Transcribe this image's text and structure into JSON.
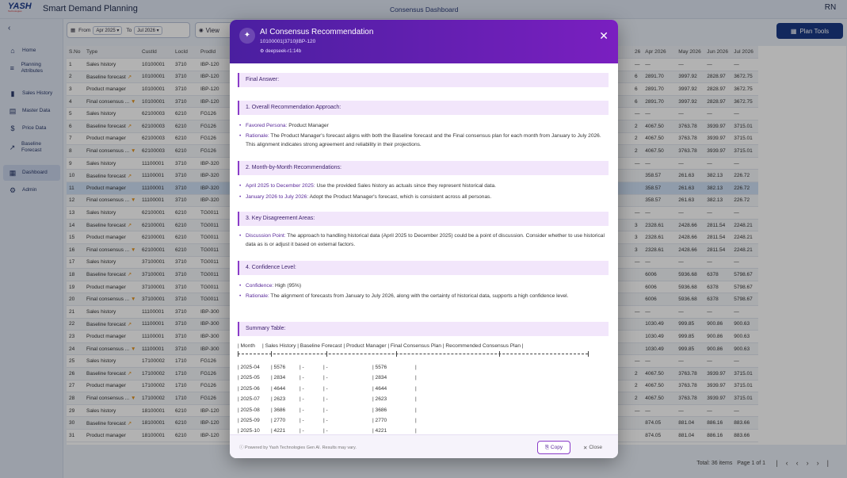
{
  "header": {
    "logo_text": "YASH",
    "logo_tagline": "Technologies",
    "app_title": "Smart Demand Planning",
    "page_title": "Consensus Dashboard",
    "user_initials": "RN"
  },
  "sidebar": {
    "collapse_icon": "chevron-left-icon",
    "items": [
      {
        "label": "Home",
        "icon": "home-icon",
        "glyph": "⌂"
      },
      {
        "label": "Planning Attributes",
        "icon": "list-icon",
        "glyph": "≡"
      },
      {
        "label": "Sales History",
        "icon": "bar-chart-icon",
        "glyph": "▮"
      },
      {
        "label": "Master Data",
        "icon": "database-icon",
        "glyph": "▤"
      },
      {
        "label": "Price Data",
        "icon": "dollar-icon",
        "glyph": "$"
      },
      {
        "label": "Baseline Forecast",
        "icon": "trend-icon",
        "glyph": "↗"
      },
      {
        "label": "Dashboard",
        "icon": "dashboard-icon",
        "glyph": "▦"
      },
      {
        "label": "Admin",
        "icon": "admin-icon",
        "glyph": "⚙"
      }
    ]
  },
  "filters": {
    "from_label": "From",
    "from_value": "Apr 2025",
    "to_label": "To",
    "to_value": "Jul 2026",
    "view_label": "View",
    "plan_tools_label": "Plan Tools"
  },
  "grid": {
    "left_headers": [
      "S.No",
      "Type",
      "CustId",
      "LocId",
      "ProdId"
    ],
    "right_headers": [
      "26",
      "Apr 2026",
      "May 2026",
      "Jun 2026",
      "Jul 2026"
    ],
    "rows": [
      {
        "n": "1",
        "type": "Sales history",
        "cust": "10100001",
        "loc": "3710",
        "prod": "IBP-120",
        "flag": "",
        "r": [
          "—",
          "—",
          "—",
          "—",
          "—"
        ]
      },
      {
        "n": "2",
        "type": "Baseline forecast",
        "cust": "10100001",
        "loc": "3710",
        "prod": "IBP-120",
        "flag": "↗",
        "r": [
          "6",
          "2891.70",
          "3997.92",
          "2828.97",
          "3672.75"
        ]
      },
      {
        "n": "3",
        "type": "Product manager",
        "cust": "10100001",
        "loc": "3710",
        "prod": "IBP-120",
        "flag": "",
        "r": [
          "6",
          "2891.70",
          "3997.92",
          "2828.97",
          "3672.75"
        ]
      },
      {
        "n": "4",
        "type": "Final consensus ...",
        "cust": "10100001",
        "loc": "3710",
        "prod": "IBP-120",
        "flag": "▼",
        "r": [
          "6",
          "2891.70",
          "3997.92",
          "2828.97",
          "3672.75"
        ]
      },
      {
        "n": "5",
        "type": "Sales history",
        "cust": "62100003",
        "loc": "6210",
        "prod": "FG126",
        "flag": "",
        "r": [
          "—",
          "—",
          "—",
          "—",
          "—"
        ]
      },
      {
        "n": "6",
        "type": "Baseline forecast",
        "cust": "62100003",
        "loc": "6210",
        "prod": "FG126",
        "flag": "↗",
        "r": [
          "2",
          "4067.50",
          "3763.78",
          "3939.97",
          "3715.01"
        ]
      },
      {
        "n": "7",
        "type": "Product manager",
        "cust": "62100003",
        "loc": "6210",
        "prod": "FG126",
        "flag": "",
        "r": [
          "2",
          "4067.50",
          "3763.78",
          "3939.97",
          "3715.01"
        ]
      },
      {
        "n": "8",
        "type": "Final consensus ...",
        "cust": "62100003",
        "loc": "6210",
        "prod": "FG126",
        "flag": "▼",
        "r": [
          "2",
          "4067.50",
          "3763.78",
          "3939.97",
          "3715.01"
        ]
      },
      {
        "n": "9",
        "type": "Sales history",
        "cust": "11100001",
        "loc": "3710",
        "prod": "IBP-320",
        "flag": "",
        "r": [
          "—",
          "—",
          "—",
          "—",
          "—"
        ]
      },
      {
        "n": "10",
        "type": "Baseline forecast",
        "cust": "11100001",
        "loc": "3710",
        "prod": "IBP-320",
        "flag": "↗",
        "r": [
          "",
          "358.57",
          "261.63",
          "382.13",
          "226.72"
        ]
      },
      {
        "n": "11",
        "type": "Product manager",
        "cust": "11100001",
        "loc": "3710",
        "prod": "IBP-320",
        "flag": "",
        "r": [
          "",
          "358.57",
          "261.63",
          "382.13",
          "226.72"
        ]
      },
      {
        "n": "12",
        "type": "Final consensus ...",
        "cust": "11100001",
        "loc": "3710",
        "prod": "IBP-320",
        "flag": "▼",
        "r": [
          "",
          "358.57",
          "261.63",
          "382.13",
          "226.72"
        ]
      },
      {
        "n": "13",
        "type": "Sales history",
        "cust": "62100001",
        "loc": "6210",
        "prod": "TG0011",
        "flag": "",
        "r": [
          "—",
          "—",
          "—",
          "—",
          "—"
        ]
      },
      {
        "n": "14",
        "type": "Baseline forecast",
        "cust": "62100001",
        "loc": "6210",
        "prod": "TG0011",
        "flag": "↗",
        "r": [
          "3",
          "2328.61",
          "2428.66",
          "2811.54",
          "2248.21"
        ]
      },
      {
        "n": "15",
        "type": "Product manager",
        "cust": "62100001",
        "loc": "6210",
        "prod": "TG0011",
        "flag": "",
        "r": [
          "3",
          "2328.61",
          "2428.66",
          "2811.54",
          "2248.21"
        ]
      },
      {
        "n": "16",
        "type": "Final consensus ...",
        "cust": "62100001",
        "loc": "6210",
        "prod": "TG0011",
        "flag": "▼",
        "r": [
          "3",
          "2328.61",
          "2428.66",
          "2811.54",
          "2248.21"
        ]
      },
      {
        "n": "17",
        "type": "Sales history",
        "cust": "37100001",
        "loc": "3710",
        "prod": "TG0011",
        "flag": "",
        "r": [
          "—",
          "—",
          "—",
          "—",
          "—"
        ]
      },
      {
        "n": "18",
        "type": "Baseline forecast",
        "cust": "37100001",
        "loc": "3710",
        "prod": "TG0011",
        "flag": "↗",
        "r": [
          "",
          "6006",
          "5936.68",
          "6378",
          "5798.67"
        ]
      },
      {
        "n": "19",
        "type": "Product manager",
        "cust": "37100001",
        "loc": "3710",
        "prod": "TG0011",
        "flag": "",
        "r": [
          "",
          "6006",
          "5936.68",
          "6378",
          "5798.67"
        ]
      },
      {
        "n": "20",
        "type": "Final consensus ...",
        "cust": "37100001",
        "loc": "3710",
        "prod": "TG0011",
        "flag": "▼",
        "r": [
          "",
          "6006",
          "5936.68",
          "6378",
          "5798.67"
        ]
      },
      {
        "n": "21",
        "type": "Sales history",
        "cust": "11100001",
        "loc": "3710",
        "prod": "IBP-300",
        "flag": "",
        "r": [
          "—",
          "—",
          "—",
          "—",
          "—"
        ]
      },
      {
        "n": "22",
        "type": "Baseline forecast",
        "cust": "11100001",
        "loc": "3710",
        "prod": "IBP-300",
        "flag": "↗",
        "r": [
          "",
          "1030.49",
          "999.85",
          "900.86",
          "900.63"
        ]
      },
      {
        "n": "23",
        "type": "Product manager",
        "cust": "11100001",
        "loc": "3710",
        "prod": "IBP-300",
        "flag": "",
        "r": [
          "",
          "1030.49",
          "999.85",
          "900.86",
          "900.63"
        ]
      },
      {
        "n": "24",
        "type": "Final consensus ...",
        "cust": "11100001",
        "loc": "3710",
        "prod": "IBP-300",
        "flag": "▼",
        "r": [
          "",
          "1030.49",
          "999.85",
          "900.86",
          "900.63"
        ]
      },
      {
        "n": "25",
        "type": "Sales history",
        "cust": "17100002",
        "loc": "1710",
        "prod": "FG126",
        "flag": "",
        "r": [
          "—",
          "—",
          "—",
          "—",
          "—"
        ]
      },
      {
        "n": "26",
        "type": "Baseline forecast",
        "cust": "17100002",
        "loc": "1710",
        "prod": "FG126",
        "flag": "↗",
        "r": [
          "2",
          "4067.50",
          "3763.78",
          "3939.97",
          "3715.01"
        ]
      },
      {
        "n": "27",
        "type": "Product manager",
        "cust": "17100002",
        "loc": "1710",
        "prod": "FG126",
        "flag": "",
        "r": [
          "2",
          "4067.50",
          "3763.78",
          "3939.97",
          "3715.01"
        ]
      },
      {
        "n": "28",
        "type": "Final consensus ...",
        "cust": "17100002",
        "loc": "1710",
        "prod": "FG126",
        "flag": "▼",
        "r": [
          "2",
          "4067.50",
          "3763.78",
          "3939.97",
          "3715.01"
        ]
      },
      {
        "n": "29",
        "type": "Sales history",
        "cust": "18100001",
        "loc": "6210",
        "prod": "IBP-120",
        "flag": "",
        "r": [
          "—",
          "—",
          "—",
          "—",
          "—"
        ]
      },
      {
        "n": "30",
        "type": "Baseline forecast",
        "cust": "18100001",
        "loc": "6210",
        "prod": "IBP-120",
        "flag": "↗",
        "r": [
          "",
          "874.05",
          "881.04",
          "886.16",
          "883.66"
        ]
      },
      {
        "n": "31",
        "type": "Product manager",
        "cust": "18100001",
        "loc": "6210",
        "prod": "IBP-120",
        "flag": "",
        "r": [
          "",
          "874.05",
          "881.04",
          "886.16",
          "883.66"
        ]
      }
    ]
  },
  "footer": {
    "total_items": "Total: 36 items",
    "page_info": "Page 1 of 1"
  },
  "modal": {
    "title": "AI Consensus Recommendation",
    "subtitle": "10100001|3710|IBP-120",
    "model": "deepseek-r1:14b",
    "sections": [
      {
        "title": "Final Answer:",
        "bullets": []
      },
      {
        "title": "1. Overall Recommendation Approach:",
        "bullets": [
          {
            "key": "Favored Persona:",
            "text": " Product Manager"
          },
          {
            "key": "Rationale:",
            "text": " The Product Manager's forecast aligns with both the Baseline forecast and the Final consensus plan for each month from January to July 2026. This alignment indicates strong agreement and reliability in their projections."
          }
        ]
      },
      {
        "title": "2. Month-by-Month Recommendations:",
        "bullets": [
          {
            "key": "April 2025 to December 2025:",
            "text": " Use the provided Sales history as actuals since they represent historical data."
          },
          {
            "key": "January 2026 to July 2026:",
            "text": " Adopt the Product Manager's forecast, which is consistent across all personas."
          }
        ]
      },
      {
        "title": "3. Key Disagreement Areas:",
        "bullets": [
          {
            "key": "Discussion Point:",
            "text": " The approach to handling historical data (April 2025 to December 2025) could be a point of discussion. Consider whether to use historical data as is or adjust it based on external factors."
          }
        ]
      },
      {
        "title": "4. Confidence Level:",
        "bullets": [
          {
            "key": "Confidence:",
            "text": " High (95%)"
          },
          {
            "key": "Rationale:",
            "text": " The alignment of forecasts from January to July 2026, along with the certainty of historical data, supports a high confidence level."
          }
        ]
      },
      {
        "title": "Summary Table:",
        "bullets": []
      }
    ],
    "summary_header": "| Month     | Sales History | Baseline Forecast | Product Manager | Final Consensus Plan | Recommended Consensus Plan |",
    "summary_rows": [
      {
        "month": "| 2025-04",
        "sales": "| 5576",
        "base": "| -",
        "pm": "| -",
        "final": "| 5576",
        "rec": "|"
      },
      {
        "month": "| 2025-05",
        "sales": "| 2834",
        "base": "| -",
        "pm": "| -",
        "final": "| 2834",
        "rec": "|"
      },
      {
        "month": "| 2025-06",
        "sales": "| 4644",
        "base": "| -",
        "pm": "| -",
        "final": "| 4644",
        "rec": "|"
      },
      {
        "month": "| 2025-07",
        "sales": "| 2623",
        "base": "| -",
        "pm": "| -",
        "final": "| 2623",
        "rec": "|"
      },
      {
        "month": "| 2025-08",
        "sales": "| 3686",
        "base": "| -",
        "pm": "| -",
        "final": "| 3686",
        "rec": "|"
      },
      {
        "month": "| 2025-09",
        "sales": "| 2770",
        "base": "| -",
        "pm": "| -",
        "final": "| 2770",
        "rec": "|"
      },
      {
        "month": "| 2025-10",
        "sales": "| 4221",
        "base": "| -",
        "pm": "| -",
        "final": "| 4221",
        "rec": "|"
      }
    ],
    "footer_note": "Powered by Yash Technologies Gen AI. Results may vary.",
    "copy_label": "Copy",
    "close_label": "Close"
  }
}
